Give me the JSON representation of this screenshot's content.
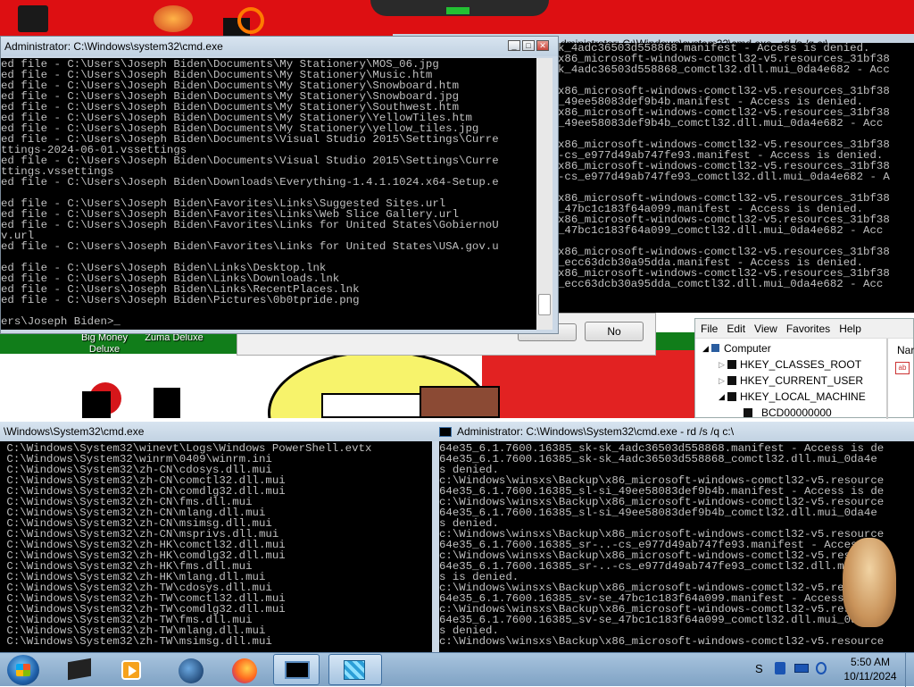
{
  "cmd_main": {
    "title": "Administrator: C:\\Windows\\system32\\cmd.exe",
    "lines": [
      "ed file - C:\\Users\\Joseph Biden\\Documents\\My Stationery\\MOS_06.jpg",
      "ed file - C:\\Users\\Joseph Biden\\Documents\\My Stationery\\Music.htm",
      "ed file - C:\\Users\\Joseph Biden\\Documents\\My Stationery\\Snowboard.htm",
      "ed file - C:\\Users\\Joseph Biden\\Documents\\My Stationery\\Snowboard.jpg",
      "ed file - C:\\Users\\Joseph Biden\\Documents\\My Stationery\\Southwest.htm",
      "ed file - C:\\Users\\Joseph Biden\\Documents\\My Stationery\\YellowTiles.htm",
      "ed file - C:\\Users\\Joseph Biden\\Documents\\My Stationery\\yellow_tiles.jpg",
      "ed file - C:\\Users\\Joseph Biden\\Documents\\Visual Studio 2015\\Settings\\Curre",
      "ttings-2024-06-01.vssettings",
      "ed file - C:\\Users\\Joseph Biden\\Documents\\Visual Studio 2015\\Settings\\Curre",
      "ttings.vssettings",
      "ed file - C:\\Users\\Joseph Biden\\Downloads\\Everything-1.4.1.1024.x64-Setup.e",
      "",
      "ed file - C:\\Users\\Joseph Biden\\Favorites\\Links\\Suggested Sites.url",
      "ed file - C:\\Users\\Joseph Biden\\Favorites\\Links\\Web Slice Gallery.url",
      "ed file - C:\\Users\\Joseph Biden\\Favorites\\Links for United States\\GobiernoU",
      "v.url",
      "ed file - C:\\Users\\Joseph Biden\\Favorites\\Links for United States\\USA.gov.u",
      "",
      "ed file - C:\\Users\\Joseph Biden\\Links\\Desktop.lnk",
      "ed file - C:\\Users\\Joseph Biden\\Links\\Downloads.lnk",
      "ed file - C:\\Users\\Joseph Biden\\Links\\RecentPlaces.lnk",
      "ed file - C:\\Users\\Joseph Biden\\Pictures\\0b0tpride.png",
      "",
      "ers\\Joseph Biden>_"
    ]
  },
  "cmd_topright": {
    "title": "Administrator: C:\\Windows\\system32\\cmd.exe - rd  /s /q c:\\",
    "lines": [
      "k_4adc36503d558868.manifest - Access is denied.",
      "x86_microsoft-windows-comctl32-v5.resources_31bf38",
      "k_4adc36503d558868_comctl32.dll.mui_0da4e682 - Acc",
      "",
      "x86_microsoft-windows-comctl32-v5.resources_31bf38",
      "_49ee58083def9b4b.manifest - Access is denied.",
      "x86_microsoft-windows-comctl32-v5.resources_31bf38",
      "_49ee58083def9b4b_comctl32.dll.mui_0da4e682 - Acc",
      "",
      "x86_microsoft-windows-comctl32-v5.resources_31bf38",
      "-cs_e977d49ab747fe93.manifest - Access is denied.",
      "x86_microsoft-windows-comctl32-v5.resources_31bf38",
      "-cs_e977d49ab747fe93_comctl32.dll.mui_0da4e682 - A",
      "",
      "x86_microsoft-windows-comctl32-v5.resources_31bf38",
      "_47bc1c183f64a099.manifest - Access is denied.",
      "x86_microsoft-windows-comctl32-v5.resources_31bf38",
      "_47bc1c183f64a099_comctl32.dll.mui_0da4e682 - Acc",
      "",
      "x86_microsoft-windows-comctl32-v5.resources_31bf38",
      "_ecc63dcb30a95dda.manifest - Access is denied.",
      "x86_microsoft-windows-comctl32-v5.resources_31bf38",
      "_ecc63dcb30a95dda_comctl32.dll.mui_0da4e682 - Acc"
    ]
  },
  "cmd_bottomleft": {
    "title": "\\Windows\\System32\\cmd.exe",
    "lines": [
      " C:\\Windows\\System32\\winevt\\Logs\\Windows PowerShell.evtx",
      " C:\\Windows\\System32\\winrm\\0409\\winrm.ini",
      " C:\\Windows\\System32\\zh-CN\\cdosys.dll.mui",
      " C:\\Windows\\System32\\zh-CN\\comctl32.dll.mui",
      " C:\\Windows\\System32\\zh-CN\\comdlg32.dll.mui",
      " C:\\Windows\\System32\\zh-CN\\fms.dll.mui",
      " C:\\Windows\\System32\\zh-CN\\mlang.dll.mui",
      " C:\\Windows\\System32\\zh-CN\\msimsg.dll.mui",
      " C:\\Windows\\System32\\zh-CN\\msprivs.dll.mui",
      " C:\\Windows\\System32\\zh-HK\\comctl32.dll.mui",
      " C:\\Windows\\System32\\zh-HK\\comdlg32.dll.mui",
      " C:\\Windows\\System32\\zh-HK\\fms.dll.mui",
      " C:\\Windows\\System32\\zh-HK\\mlang.dll.mui",
      " C:\\Windows\\System32\\zh-TW\\cdosys.dll.mui",
      " C:\\Windows\\System32\\zh-TW\\comctl32.dll.mui",
      " C:\\Windows\\System32\\zh-TW\\comdlg32.dll.mui",
      " C:\\Windows\\System32\\zh-TW\\fms.dll.mui",
      " C:\\Windows\\System32\\zh-TW\\mlang.dll.mui",
      " C:\\Windows\\System32\\zh-TW\\msimsg.dll.mui"
    ]
  },
  "cmd_bottomright": {
    "title": "Administrator: C:\\Windows\\System32\\cmd.exe - rd  /s /q c:\\",
    "lines": [
      "64e35_6.1.7600.16385_sk-sk_4adc36503d558868.manifest - Access is de",
      "64e35_6.1.7600.16385_sk-sk_4adc36503d558868_comctl32.dll.mui_0da4e",
      "s denied.",
      "c:\\Windows\\winsxs\\Backup\\x86_microsoft-windows-comctl32-v5.resource",
      "64e35_6.1.7600.16385_sl-si_49ee58083def9b4b.manifest - Access is de",
      "c:\\Windows\\winsxs\\Backup\\x86_microsoft-windows-comctl32-v5.resource",
      "64e35_6.1.7600.16385_sl-si_49ee58083def9b4b_comctl32.dll.mui_0da4e",
      "s denied.",
      "c:\\Windows\\winsxs\\Backup\\x86_microsoft-windows-comctl32-v5.resource",
      "64e35_6.1.7600.16385_sr-..-cs_e977d49ab747fe93.manifest - Access is",
      "c:\\Windows\\winsxs\\Backup\\x86_microsoft-windows-comctl32-v5.resource",
      "64e35_6.1.7600.16385_sr-..-cs_e977d49ab747fe93_comctl32.dll.mui_0da",
      "s is denied.",
      "c:\\Windows\\winsxs\\Backup\\x86_microsoft-windows-comctl32-v5.resource",
      "64e35_6.1.7600.16385_sv-se_47bc1c183f64a099.manifest - Access is de",
      "c:\\Windows\\winsxs\\Backup\\x86_microsoft-windows-comctl32-v5.resource",
      "64e35_6.1.7600.16385_sv-se_47bc1c183f64a099_comctl32.dll.mui_0da4e",
      "s denied.",
      "c:\\Windows\\winsxs\\Backup\\x86_microsoft-windows-comctl32-v5.resource"
    ]
  },
  "dialog": {
    "no_label": "No"
  },
  "desktop_icons": {
    "big_money": "Big Money\nDeluxe",
    "zuma": "Zuma Deluxe"
  },
  "regedit": {
    "menu": [
      "File",
      "Edit",
      "View",
      "Favorites",
      "Help"
    ],
    "tree": [
      "Computer",
      "HKEY_CLASSES_ROOT",
      "HKEY_CURRENT_USER",
      "HKEY_LOCAL_MACHINE",
      "BCD00000000"
    ],
    "name_header": "Nar"
  },
  "clock": {
    "time": "5:50 AM",
    "date": "10/11/2024"
  }
}
